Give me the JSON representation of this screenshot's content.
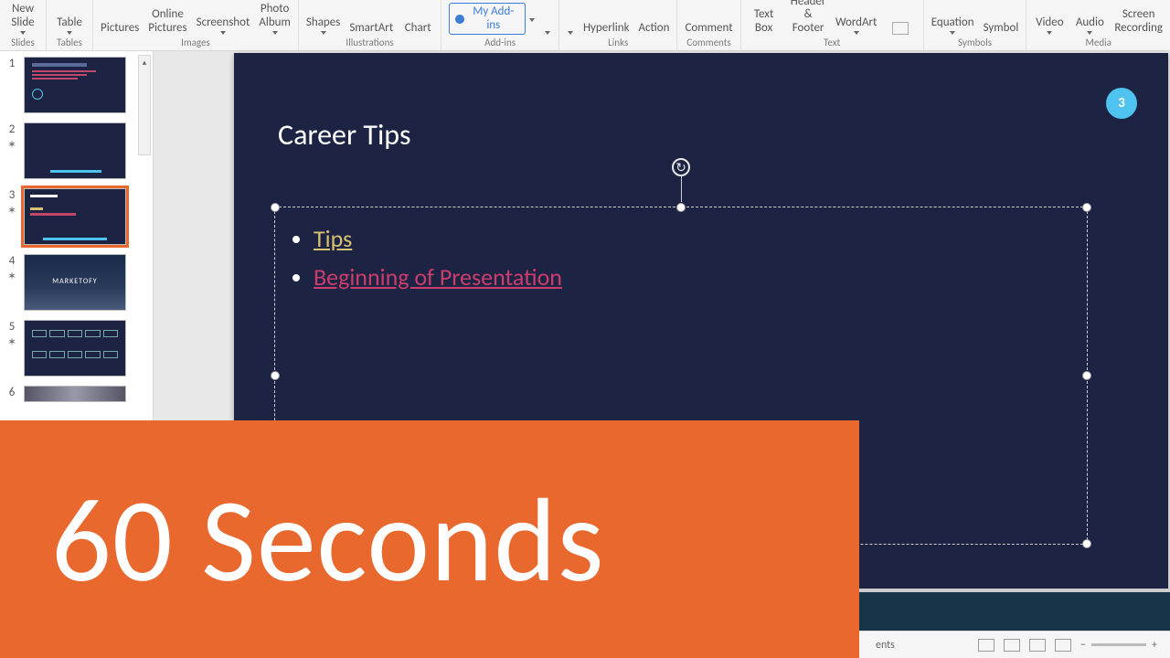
{
  "ribbon": {
    "groups": [
      {
        "name": "Slides",
        "items": [
          {
            "label": "New\nSlide",
            "arrow": true
          }
        ]
      },
      {
        "name": "Tables",
        "items": [
          {
            "label": "Table",
            "arrow": true
          }
        ]
      },
      {
        "name": "Images",
        "items": [
          {
            "label": "Pictures"
          },
          {
            "label": "Online\nPictures"
          },
          {
            "label": "Screenshot",
            "arrow": true
          },
          {
            "label": "Photo\nAlbum",
            "arrow": true
          }
        ]
      },
      {
        "name": "Illustrations",
        "items": [
          {
            "label": "Shapes",
            "arrow": true
          },
          {
            "label": "SmartArt"
          },
          {
            "label": "Chart"
          }
        ]
      },
      {
        "name": "Add-ins",
        "items": [
          {
            "label": "My Add-ins",
            "pill": true,
            "arrow": true
          }
        ],
        "sidearrow": true
      },
      {
        "name": "Links",
        "items": [
          {
            "label": "Hyperlink"
          },
          {
            "label": "Action"
          }
        ],
        "sidearrow": true
      },
      {
        "name": "Comments",
        "items": [
          {
            "label": "Comment"
          }
        ]
      },
      {
        "name": "Text",
        "items": [
          {
            "label": "Text\nBox"
          },
          {
            "label": "Header\n& Footer"
          },
          {
            "label": "WordArt",
            "arrow": true
          },
          {
            "label": "",
            "icon": true
          }
        ]
      },
      {
        "name": "Symbols",
        "items": [
          {
            "label": "Equation",
            "arrow": true
          },
          {
            "label": "Symbol"
          }
        ]
      },
      {
        "name": "Media",
        "items": [
          {
            "label": "Video",
            "arrow": true
          },
          {
            "label": "Audio",
            "arrow": true
          },
          {
            "label": "Screen\nRecording"
          }
        ]
      }
    ]
  },
  "thumbnails": {
    "items": [
      {
        "num": "1",
        "star": false,
        "selected": false,
        "variant": "agenda"
      },
      {
        "num": "2",
        "star": true,
        "selected": false,
        "variant": "dark"
      },
      {
        "num": "3",
        "star": true,
        "selected": true,
        "variant": "career"
      },
      {
        "num": "4",
        "star": true,
        "selected": false,
        "variant": "marketofy"
      },
      {
        "num": "5",
        "star": true,
        "selected": false,
        "variant": "icons"
      },
      {
        "num": "6",
        "star": false,
        "selected": false,
        "variant": "photo"
      }
    ]
  },
  "slide": {
    "title": "Career Tips",
    "page_number": "3",
    "bullets": {
      "a_text": "Tips",
      "b_text": "Beginning of Presentation"
    }
  },
  "banner": {
    "text": "60 Seconds"
  },
  "statusbar": {
    "notes_hint": "ents",
    "zoom_minus": "−",
    "zoom_plus": "+"
  },
  "colors": {
    "slide_bg": "#1d2443",
    "accent_orange": "#e8682e",
    "badge_blue": "#4fc3f0",
    "link_gold": "#d8c170",
    "link_magenta": "#cc3d6d"
  }
}
